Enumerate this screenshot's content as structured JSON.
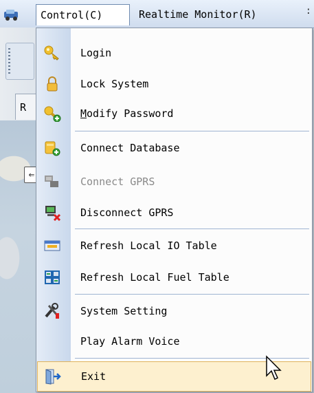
{
  "menubar": {
    "items": [
      {
        "label": "Control(C)"
      },
      {
        "label": "Realtime Monitor(R)"
      }
    ],
    "overflow": ":"
  },
  "background": {
    "tab_fragment": "R",
    "map_button_glyph": "⇐"
  },
  "menu": {
    "items": [
      {
        "label": "Login",
        "icon": "key-icon",
        "enabled": true
      },
      {
        "label": "Lock System",
        "icon": "padlock-icon",
        "enabled": true
      },
      {
        "label": "Modify Password",
        "mnemonic": "M",
        "icon": "key-add-icon",
        "enabled": true
      },
      {
        "label": "Connect Database",
        "icon": "database-add-icon",
        "enabled": true
      },
      {
        "label": "Connect GPRS",
        "icon": "network-connect-icon",
        "enabled": false
      },
      {
        "label": "Disconnect GPRS",
        "icon": "network-disconnect-icon",
        "enabled": true
      },
      {
        "label": "Refresh Local IO Table",
        "icon": "refresh-io-table-icon",
        "enabled": true
      },
      {
        "label": "Refresh Local Fuel Table",
        "icon": "refresh-fuel-table-icon",
        "enabled": true
      },
      {
        "label": "System Setting",
        "icon": "tools-icon",
        "enabled": true
      },
      {
        "label": "Play Alarm Voice",
        "icon": "",
        "enabled": true
      },
      {
        "label": "Exit",
        "icon": "exit-door-icon",
        "enabled": true,
        "highlighted": true
      }
    ]
  },
  "colors": {
    "highlight_bg": "#fdf0cf",
    "highlight_border": "#e0b25a",
    "separator": "#9fb4d2"
  }
}
